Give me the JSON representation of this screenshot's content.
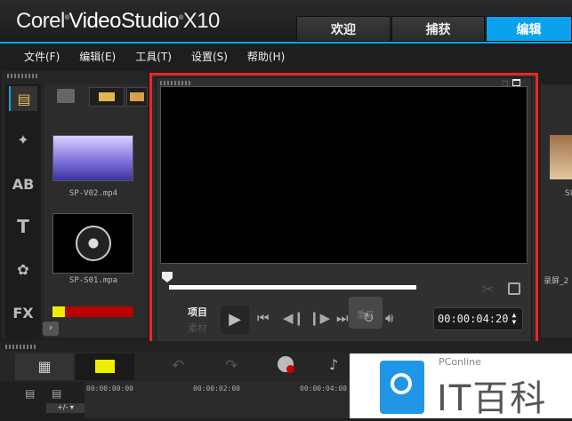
{
  "app": {
    "logo_corel": "Corel",
    "logo_product": "VideoStudio",
    "logo_version": "X10"
  },
  "tabs": [
    {
      "label": "欢迎"
    },
    {
      "label": "捕获"
    },
    {
      "label": "编辑",
      "active": true
    }
  ],
  "menu": [
    "文件(F)",
    "编辑(E)",
    "工具(T)",
    "设置(S)",
    "帮助(H)"
  ],
  "library": {
    "items": [
      {
        "name": "SP-V02.mp4"
      },
      {
        "name": "SP-S01.mpa"
      }
    ],
    "right_items": [
      "SI",
      "录屏_2"
    ]
  },
  "player": {
    "mode_project": "项目",
    "mode_clip": "素材",
    "timecode": "00:00:04:20",
    "tooltip": "重复"
  },
  "timeline": {
    "ruler": [
      "00:00:00:00",
      "00:00:02:00",
      "00:00:04:00"
    ],
    "zoom_label": "+/- ▾"
  },
  "watermark": {
    "brand": "PConline",
    "title": "IT百科"
  },
  "colors": {
    "accent": "#0aa2ef",
    "highlight_box": "#e8262b"
  }
}
